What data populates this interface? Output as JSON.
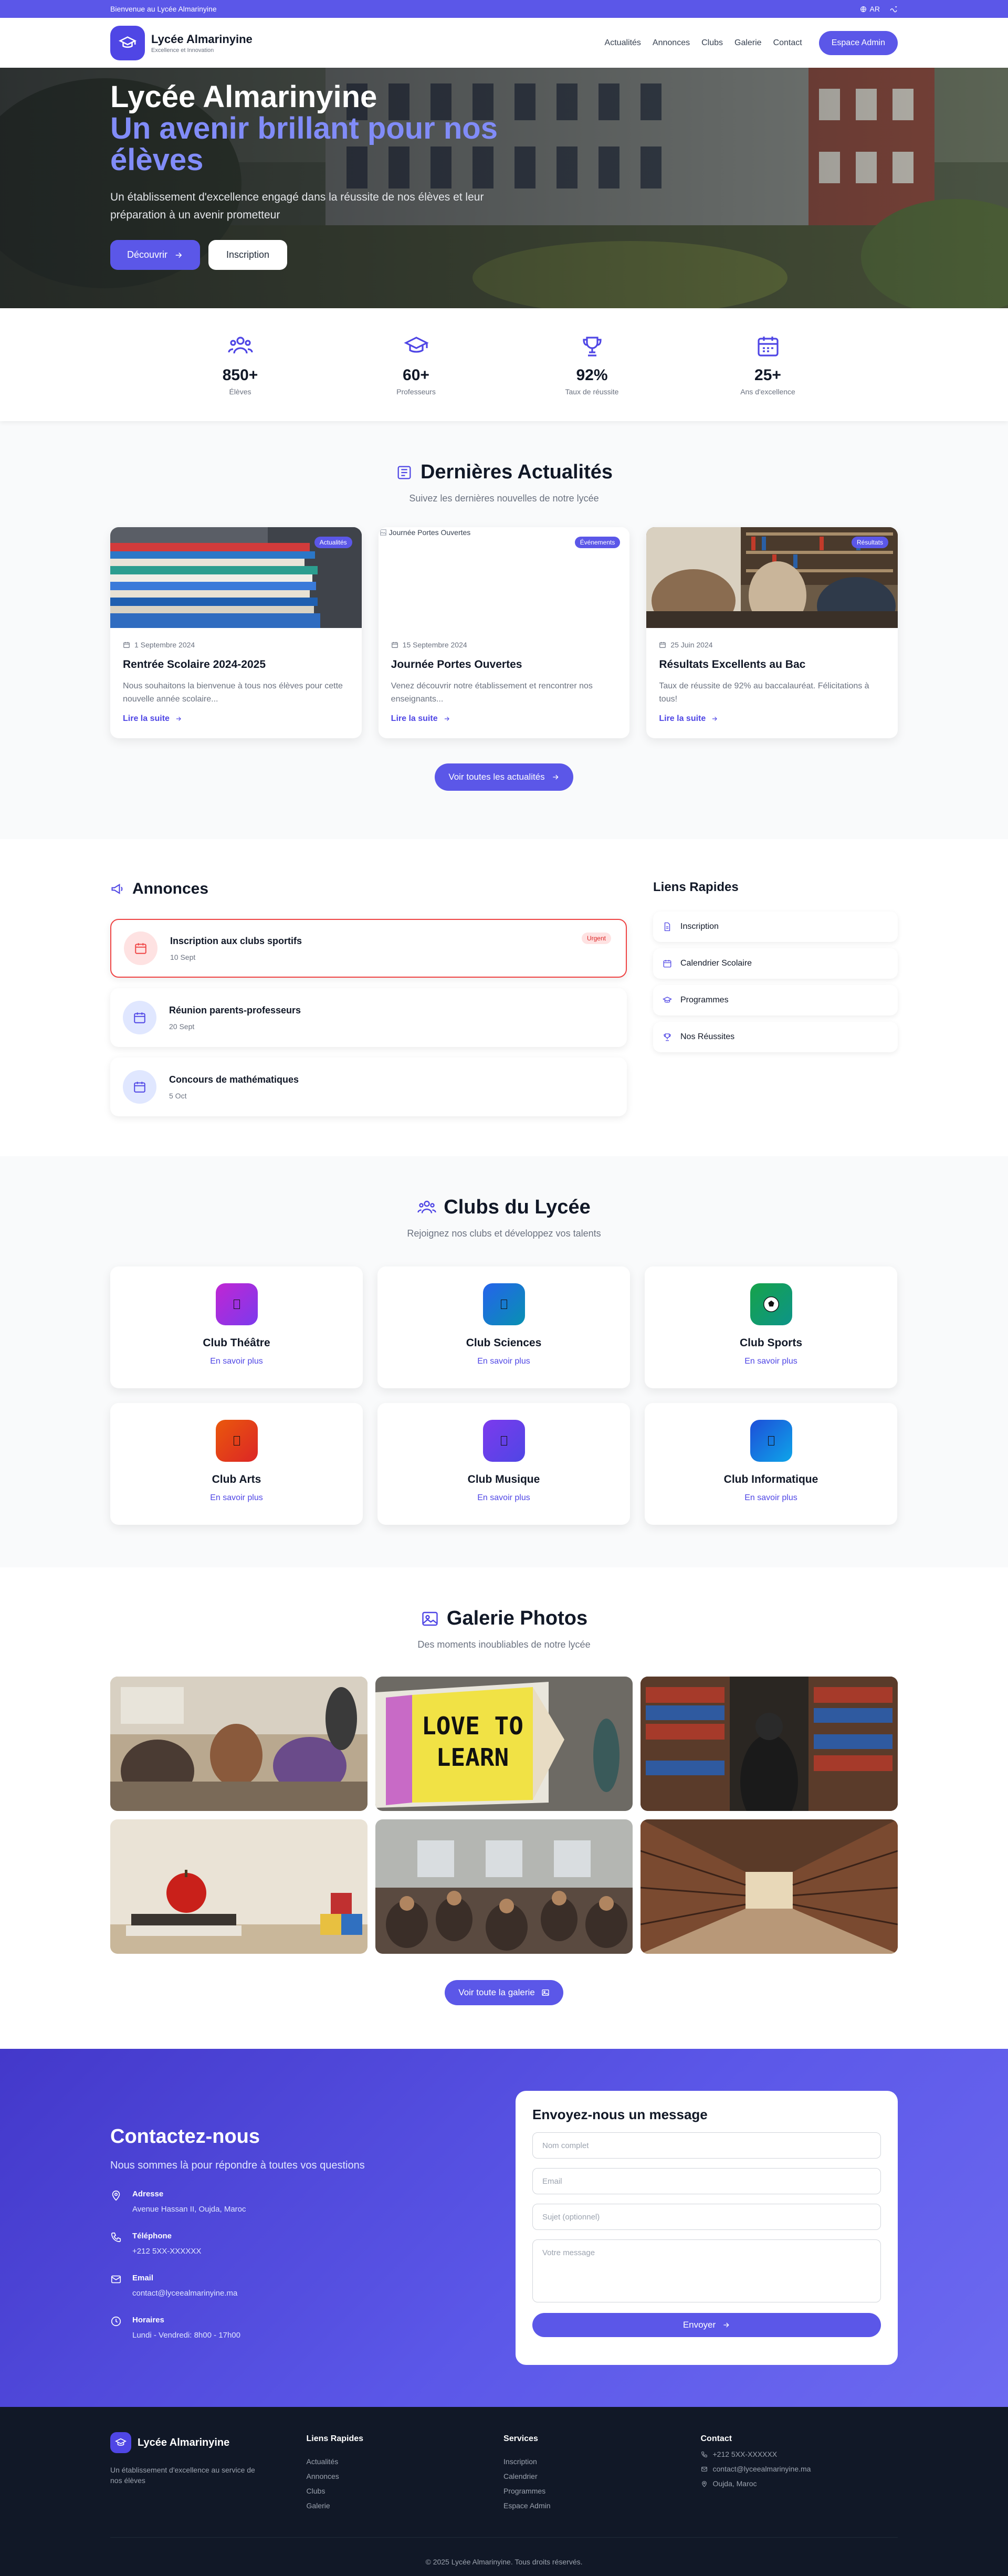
{
  "topbar": {
    "welcome": "Bienvenue au Lycée Almarinyine",
    "lang": "AR"
  },
  "header": {
    "school_name": "Lycée Almarinyine",
    "tagline": "Excellence et Innovation",
    "nav": [
      "Actualités",
      "Annonces",
      "Clubs",
      "Galerie",
      "Contact"
    ],
    "admin_button": "Espace Admin"
  },
  "hero": {
    "title_line1": "Lycée Almarinyine",
    "title_accent": "Un avenir brillant pour nos élèves",
    "description": "Un établissement d'excellence engagé dans la réussite de nos élèves et leur préparation à un avenir prometteur",
    "btn_discover": "Découvrir",
    "btn_signup": "Inscription"
  },
  "stats": [
    {
      "value": "850+",
      "label": "Élèves",
      "icon": "users-icon"
    },
    {
      "value": "60+",
      "label": "Professeurs",
      "icon": "graduation-cap-icon"
    },
    {
      "value": "92%",
      "label": "Taux de réussite",
      "icon": "trophy-icon"
    },
    {
      "value": "25+",
      "label": "Ans d'excellence",
      "icon": "calendar-icon"
    }
  ],
  "news": {
    "title": "Dernières Actualités",
    "subtitle": "Suivez les dernières nouvelles de notre lycée",
    "read_more": "Lire la suite",
    "view_all": "Voir toutes les actualités",
    "items": [
      {
        "badge": "Actualités",
        "date": "1 Septembre 2024",
        "title": "Rentrée Scolaire 2024-2025",
        "excerpt": "Nous souhaitons la bienvenue à tous nos élèves pour cette nouvelle année scolaire..."
      },
      {
        "badge": "Événements",
        "date": "15 Septembre 2024",
        "title": "Journée Portes Ouvertes",
        "excerpt": "Venez découvrir notre établissement et rencontrer nos enseignants...",
        "img_alt": "Journée Portes Ouvertes"
      },
      {
        "badge": "Résultats",
        "date": "25 Juin 2024",
        "title": "Résultats Excellents au Bac",
        "excerpt": "Taux de réussite de 92% au baccalauréat. Félicitations à tous!"
      }
    ]
  },
  "annonces": {
    "title": "Annonces",
    "urgent_label": "Urgent",
    "items": [
      {
        "title": "Inscription aux clubs sportifs",
        "date": "10 Sept"
      },
      {
        "title": "Réunion parents-professeurs",
        "date": "20 Sept"
      },
      {
        "title": "Concours de mathématiques",
        "date": "5 Oct"
      }
    ]
  },
  "quick_links": {
    "title": "Liens Rapides",
    "items": [
      "Inscription",
      "Calendrier Scolaire",
      "Programmes",
      "Nos Réussites"
    ]
  },
  "clubs": {
    "title": "Clubs du Lycée",
    "subtitle": "Rejoignez nos clubs et développez vos talents",
    "learn_more": "En savoir plus",
    "items": [
      {
        "name": "Club Théâtre",
        "color": "#c026d3"
      },
      {
        "name": "Club Sciences",
        "color": "#2563eb"
      },
      {
        "name": "Club Sports",
        "color": "#16a34a"
      },
      {
        "name": "Club Arts",
        "color": "#ea580c"
      },
      {
        "name": "Club Musique",
        "color": "#7c3aed"
      },
      {
        "name": "Club Informatique",
        "color": "#1d4ed8"
      }
    ]
  },
  "gallery": {
    "title": "Galerie Photos",
    "subtitle": "Des moments inoubliables de notre lycée",
    "view_all": "Voir toute la galerie",
    "sign_text_line1": "LOVE TO",
    "sign_text_line2": "LEARN"
  },
  "contact": {
    "title": "Contactez-nous",
    "lead": "Nous sommes là pour répondre à toutes vos questions",
    "address_label": "Adresse",
    "address": "Avenue Hassan II, Oujda, Maroc",
    "phone_label": "Téléphone",
    "phone": "+212 5XX-XXXXXX",
    "email_label": "Email",
    "email": "contact@lyceealmarinyine.ma",
    "hours_label": "Horaires",
    "hours": "Lundi - Vendredi: 8h00 - 17h00",
    "form": {
      "title": "Envoyez-nous un message",
      "name_placeholder": "Nom complet",
      "email_placeholder": "Email",
      "subject_placeholder": "Sujet (optionnel)",
      "message_placeholder": "Votre message",
      "submit": "Envoyer"
    }
  },
  "footer": {
    "brand": "Lycée Almarinyine",
    "description": "Un établissement d'excellence au service de nos élèves",
    "links_title": "Liens Rapides",
    "links": [
      "Actualités",
      "Annonces",
      "Clubs",
      "Galerie"
    ],
    "services_title": "Services",
    "services": [
      "Inscription",
      "Calendrier",
      "Programmes",
      "Espace Admin"
    ],
    "contact_title": "Contact",
    "phone": "+212 5XX-XXXXXX",
    "email": "contact@lyceealmarinyine.ma",
    "city": "Oujda, Maroc",
    "copyright": "© 2025 Lycée Almarinyine. Tous droits réservés."
  }
}
